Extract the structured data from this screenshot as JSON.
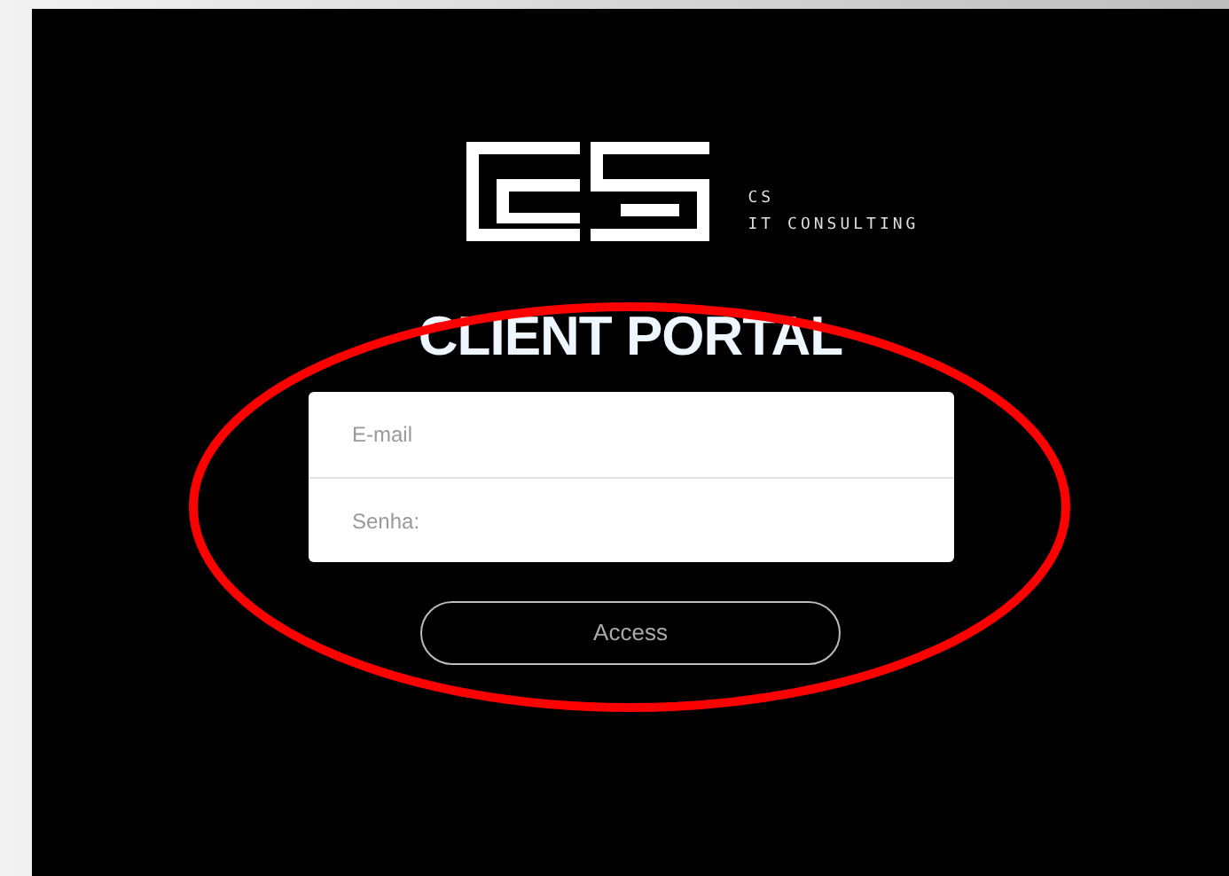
{
  "brand": {
    "name": "CS",
    "tagline": "IT CONSULTING"
  },
  "title": "CLIENT PORTAL",
  "form": {
    "fields": [
      {
        "placeholder": "E-mail"
      },
      {
        "placeholder": "Senha:"
      }
    ],
    "submit": "Access"
  }
}
